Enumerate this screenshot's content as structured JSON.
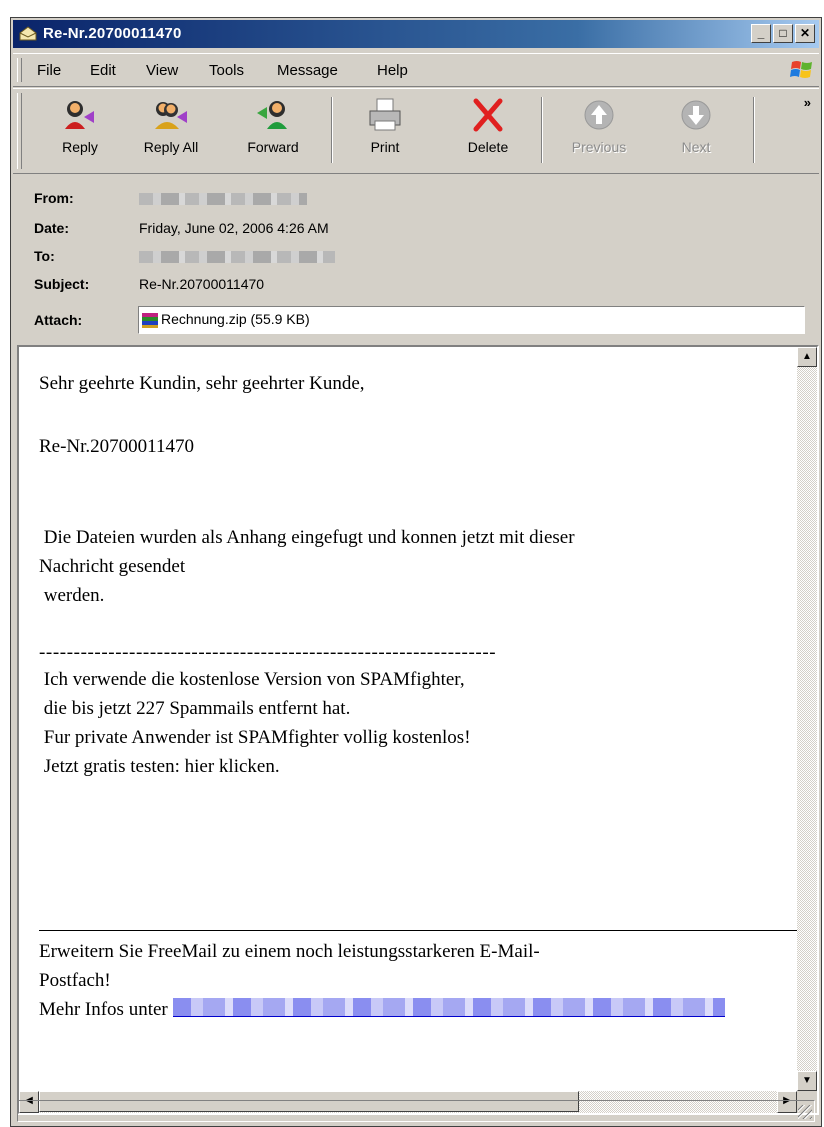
{
  "window": {
    "title": "Re-Nr.20700011470"
  },
  "menu": [
    {
      "label": "File"
    },
    {
      "label": "Edit"
    },
    {
      "label": "View"
    },
    {
      "label": "Tools"
    },
    {
      "label": "Message"
    },
    {
      "label": "Help"
    }
  ],
  "toolbar": {
    "reply": "Reply",
    "reply_all": "Reply All",
    "forward": "Forward",
    "print": "Print",
    "delete": "Delete",
    "previous": "Previous",
    "next": "Next",
    "overflow": "»"
  },
  "header": {
    "from_label": "From:",
    "date_label": "Date:",
    "to_label": "To:",
    "subject_label": "Subject:",
    "attach_label": "Attach:",
    "date": "Friday, June 02, 2006 4:26 AM",
    "subject": "Re-Nr.20700011470",
    "attachment": "Rechnung.zip (55.9 KB)"
  },
  "body": {
    "greeting": "Sehr geehrte Kundin, sehr geehrter Kunde,",
    "ref": "Re-Nr.20700011470",
    "para1_line1": " Die Dateien wurden als Anhang eingefugt und konnen jetzt mit dieser",
    "para1_line2": "Nachricht gesendet",
    "para1_line3": " werden.",
    "dashes": "------------------------------------------------------------------",
    "spam1": " Ich verwende die kostenlose Version von SPAMfighter,",
    "spam2": " die bis jetzt 227 Spammails entfernt hat.",
    "spam3": " Fur private Anwender ist SPAMfighter vollig kostenlos!",
    "spam4": " Jetzt gratis testen: hier klicken.",
    "footer1": "Erweitern Sie FreeMail zu einem noch leistungsstarkeren E-Mail-",
    "footer2": "Postfach!",
    "footer3": "Mehr Infos unter "
  }
}
